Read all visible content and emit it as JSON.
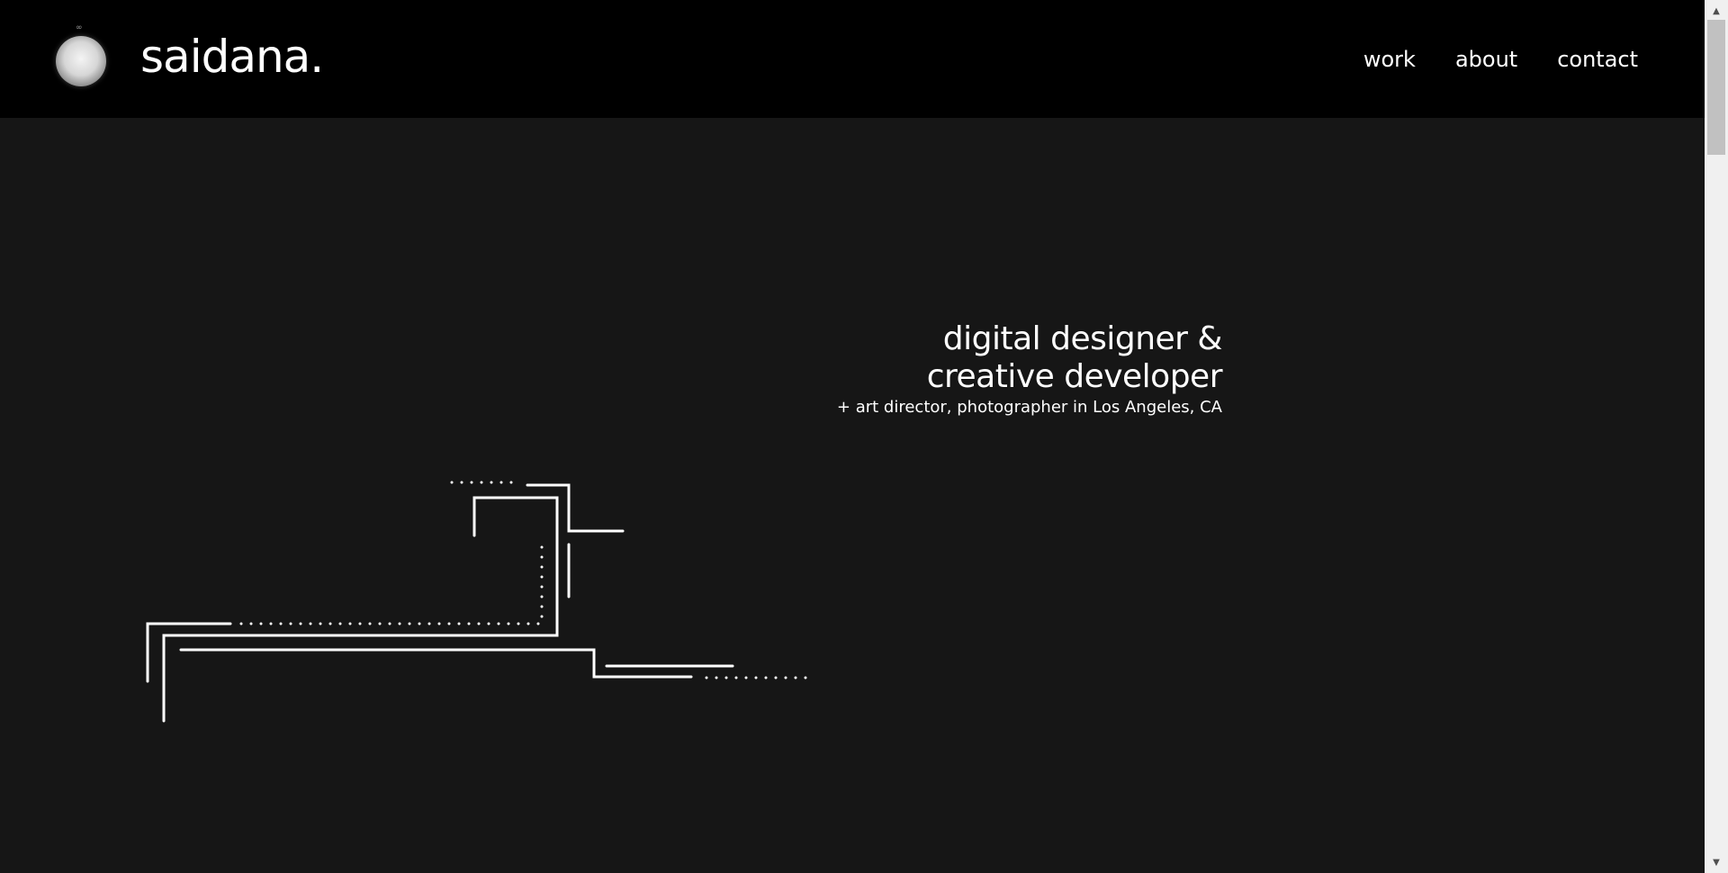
{
  "header": {
    "brand": "saidana.",
    "logo_mark": "∞",
    "nav": [
      {
        "label": "work"
      },
      {
        "label": "about"
      },
      {
        "label": "contact"
      }
    ]
  },
  "hero": {
    "line1": "digital designer &",
    "line2": "creative developer",
    "sub": "+ art director, photographer in Los Angeles, CA"
  },
  "scrollbar": {
    "up_icon": "▲",
    "down_icon": "▼"
  },
  "colors": {
    "header_bg": "#000000",
    "page_bg": "#161616",
    "text": "#ffffff",
    "line": "#ffffff"
  }
}
